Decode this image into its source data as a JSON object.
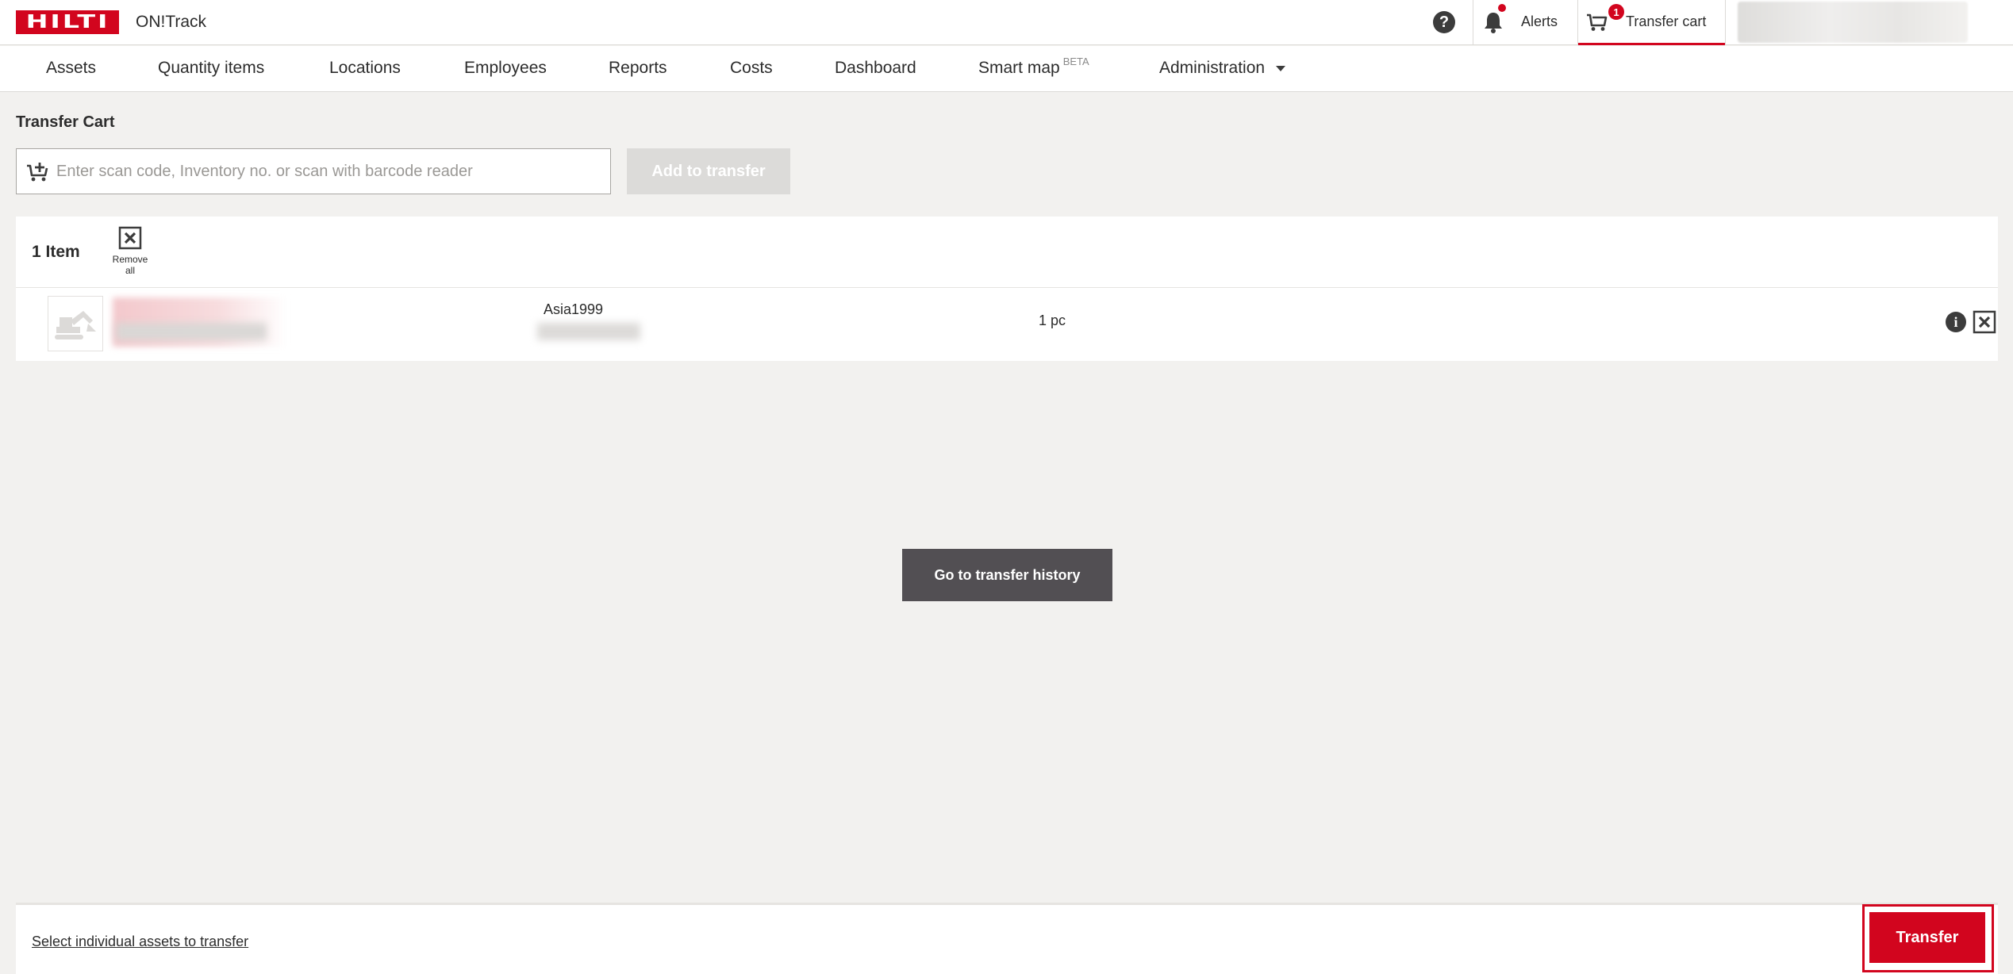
{
  "header": {
    "logo_text": "HILTI",
    "app_name": "ON!Track",
    "help_icon": "?",
    "alerts_label": "Alerts",
    "cart_label": "Transfer cart",
    "cart_badge": "1"
  },
  "nav": {
    "items": [
      "Assets",
      "Quantity items",
      "Locations",
      "Employees",
      "Reports",
      "Costs",
      "Dashboard",
      "Smart map",
      "Administration"
    ],
    "smart_map_badge": "BETA"
  },
  "transfer_cart": {
    "title": "Transfer Cart",
    "scan_placeholder": "Enter scan code, Inventory no. or scan with barcode reader",
    "scan_value": "",
    "add_button": "Add to transfer",
    "item_count": "1 Item",
    "remove_all_label": [
      "Remove",
      "all"
    ],
    "items": [
      {
        "code": "Asia1999",
        "quantity": "1 pc"
      }
    ],
    "info_icon": "i",
    "history_button": "Go to transfer history"
  },
  "footer": {
    "select_link": "Select individual assets to transfer",
    "transfer_button": "Transfer"
  },
  "colors": {
    "brand_red": "#d2051e",
    "background": "#f2f1ef",
    "dark_button": "#524f53",
    "disabled_button": "#dcdbd9"
  },
  "icons": {
    "help": "question-circle-icon",
    "alerts": "bell-icon",
    "cart": "cart-icon",
    "scan": "cart-add-icon",
    "remove": "close-box-icon",
    "info": "info-icon",
    "thumbnail": "excavator-icon"
  }
}
